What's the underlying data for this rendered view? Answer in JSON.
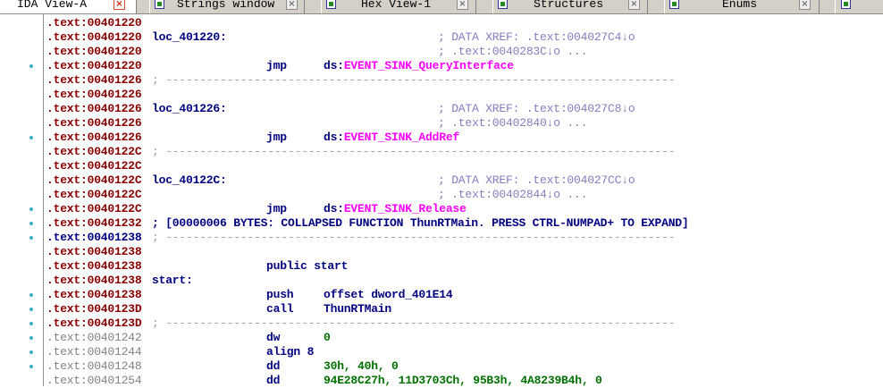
{
  "tabs": [
    {
      "label": "IDA View-A",
      "icon": "ida-view-icon",
      "active": true
    },
    {
      "label": "Strings window",
      "icon": "strings-icon",
      "active": false
    },
    {
      "label": "Hex View-1",
      "icon": "hex-icon",
      "active": false
    },
    {
      "label": "Structures",
      "icon": "structures-icon",
      "active": false
    },
    {
      "label": "Enums",
      "icon": "enums-icon",
      "active": false
    }
  ],
  "close_glyph": "×",
  "listing": [
    {
      "addr": ".text:00401220",
      "addr_style": "red"
    },
    {
      "addr": ".text:00401220",
      "addr_style": "red",
      "label": "loc_401220:",
      "comment": "; DATA XREF: .text:004027C4↓o"
    },
    {
      "addr": ".text:00401220",
      "addr_style": "red",
      "comment": "; .text:0040283C↓o ..."
    },
    {
      "addr": ".text:00401220",
      "addr_style": "red",
      "mnemonic": "jmp",
      "op_prefix": "ds:",
      "op_import": "EVENT_SINK_QueryInterface"
    },
    {
      "addr": ".text:00401226",
      "addr_style": "red",
      "separator": "; ---------------------------------------------------------------------------"
    },
    {
      "addr": ".text:00401226",
      "addr_style": "red"
    },
    {
      "addr": ".text:00401226",
      "addr_style": "red",
      "label": "loc_401226:",
      "comment": "; DATA XREF: .text:004027C8↓o"
    },
    {
      "addr": ".text:00401226",
      "addr_style": "red",
      "comment": "; .text:00402840↓o ..."
    },
    {
      "addr": ".text:00401226",
      "addr_style": "red",
      "mnemonic": "jmp",
      "op_prefix": "ds:",
      "op_import": "EVENT_SINK_AddRef"
    },
    {
      "addr": ".text:0040122C",
      "addr_style": "red",
      "separator": "; ---------------------------------------------------------------------------"
    },
    {
      "addr": ".text:0040122C",
      "addr_style": "red"
    },
    {
      "addr": ".text:0040122C",
      "addr_style": "red",
      "label": "loc_40122C:",
      "comment": "; DATA XREF: .text:004027CC↓o"
    },
    {
      "addr": ".text:0040122C",
      "addr_style": "red",
      "comment": "; .text:00402844↓o ..."
    },
    {
      "addr": ".text:0040122C",
      "addr_style": "red",
      "mnemonic": "jmp",
      "op_prefix": "ds:",
      "op_import": "EVENT_SINK_Release"
    },
    {
      "addr": ".text:00401232",
      "addr_style": "red",
      "collapsed": "; [00000006 BYTES: COLLAPSED FUNCTION ThunRTMain. PRESS CTRL-NUMPAD+ TO EXPAND]"
    },
    {
      "addr": ".text:00401238",
      "addr_style": "blue",
      "separator": "; ---------------------------------------------------------------------------"
    },
    {
      "addr": ".text:00401238",
      "addr_style": "red"
    },
    {
      "addr": ".text:00401238",
      "addr_style": "red",
      "mnemonic": "public start"
    },
    {
      "addr": ".text:00401238",
      "addr_style": "red",
      "label": "start:"
    },
    {
      "addr": ".text:00401238",
      "addr_style": "red",
      "mnemonic": "push",
      "op_prefix": "offset dword_401E14"
    },
    {
      "addr": ".text:0040123D",
      "addr_style": "red",
      "mnemonic": "call",
      "op_prefix": "ThunRTMain"
    },
    {
      "addr": ".text:0040123D",
      "addr_style": "red",
      "separator": "; ---------------------------------------------------------------------------"
    },
    {
      "addr": ".text:00401242",
      "addr_style": "grey",
      "mnemonic": "dw",
      "op_number": "0"
    },
    {
      "addr": ".text:00401244",
      "addr_style": "grey",
      "mnemonic": "align 8"
    },
    {
      "addr": ".text:00401248",
      "addr_style": "grey",
      "mnemonic": "dd",
      "op_number": "30h, 40h, 0"
    },
    {
      "addr": ".text:00401254",
      "addr_style": "grey",
      "mnemonic": "dd",
      "op_number": "94E28C27h, 11D3703Ch, 95B3h, 4A8239B4h, 0"
    }
  ],
  "colors": {
    "address_red": "#880000",
    "address_blue": "#000080",
    "address_grey": "#808080",
    "import_name": "#ff00ff",
    "comment": "#7f7fbf",
    "number": "#007000",
    "breakpoint_dot": "#3ab0c8"
  }
}
